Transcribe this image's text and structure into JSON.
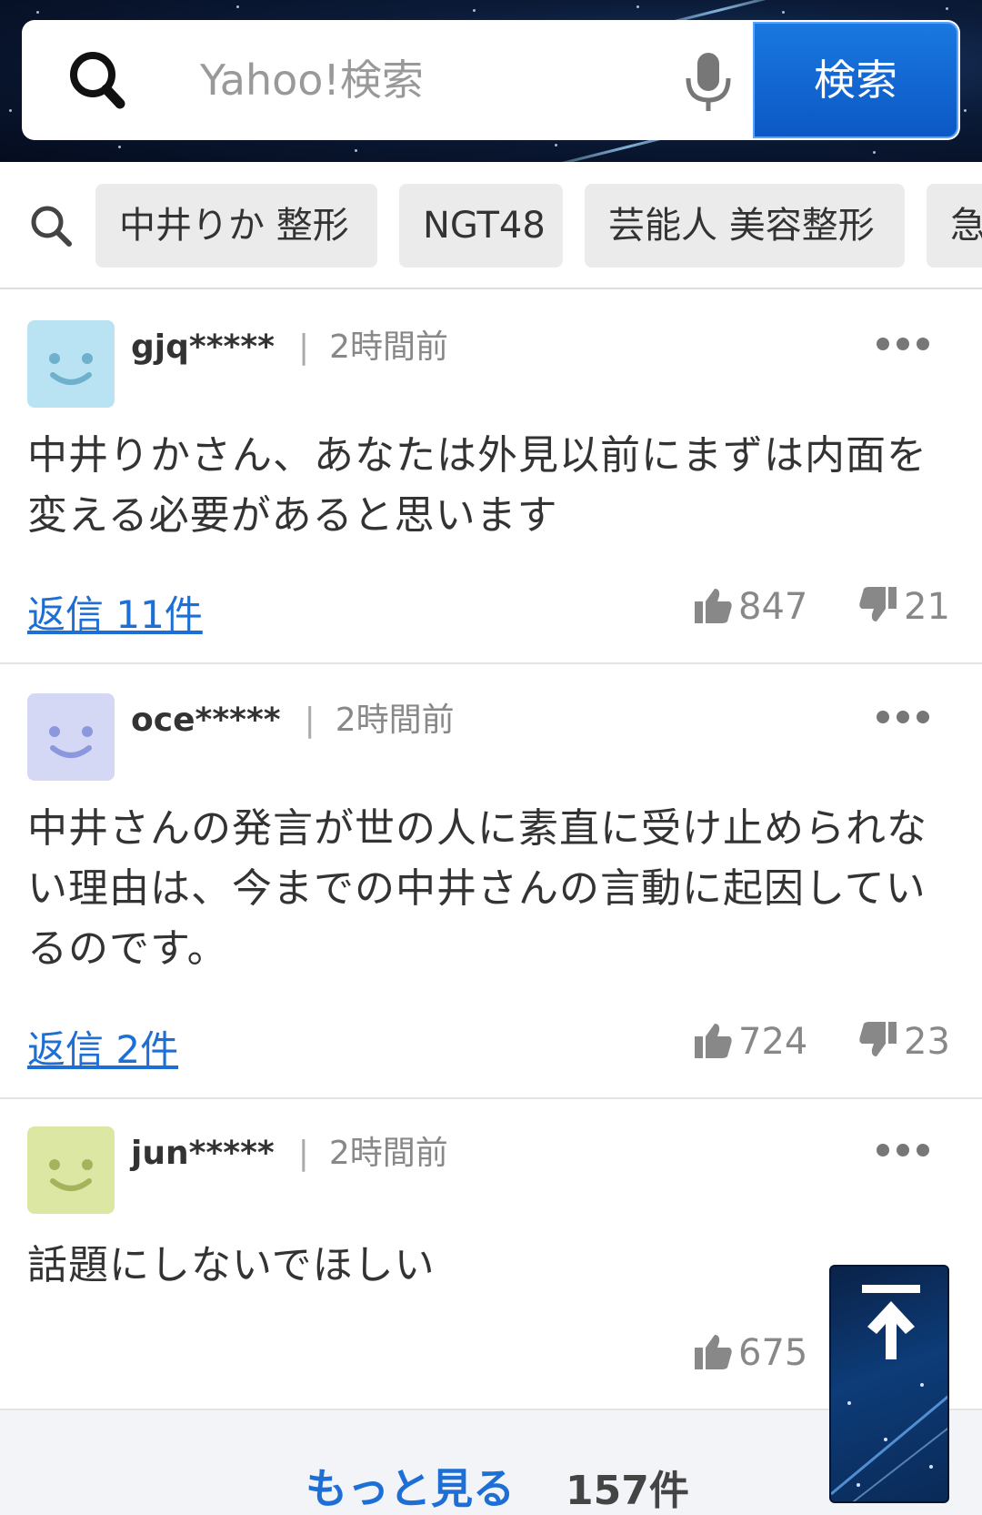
{
  "search": {
    "placeholder": "Yahoo!検索",
    "button_label": "検索"
  },
  "suggestions": [
    "中井りか 整形",
    "NGT48",
    "芸能人 美容整形",
    "急"
  ],
  "comments": [
    {
      "username": "gjq*****",
      "time": "2時間前",
      "avatar_color": "#b9e3f2",
      "text_lines": [
        "中井りかさん、あなたは外見以前にまずは内面を",
        "変える必要があると思います"
      ],
      "reply_label": "返信 11件",
      "likes": "847",
      "dislikes": "21"
    },
    {
      "username": "oce*****",
      "time": "2時間前",
      "avatar_color": "#d5d8f5",
      "text_lines": [
        "中井さんの発言が世の人に素直に受け止められな",
        "い理由は、今までの中井さんの言動に起因してい",
        "るのです。"
      ],
      "reply_label": "返信 2件",
      "likes": "724",
      "dislikes": "23"
    },
    {
      "username": "jun*****",
      "time": "2時間前",
      "avatar_color": "#dbe7a3",
      "text_lines": [
        "話題にしないでほしい"
      ],
      "likes": "675"
    }
  ],
  "footer": {
    "more_label": "もっと見る",
    "count": "157件"
  },
  "icons": {
    "search": "search-icon",
    "mic": "mic-icon",
    "more": "more-options-icon",
    "like": "thumbs-up-icon",
    "dislike": "thumbs-down-icon",
    "back_to_top": "arrow-up-icon"
  }
}
